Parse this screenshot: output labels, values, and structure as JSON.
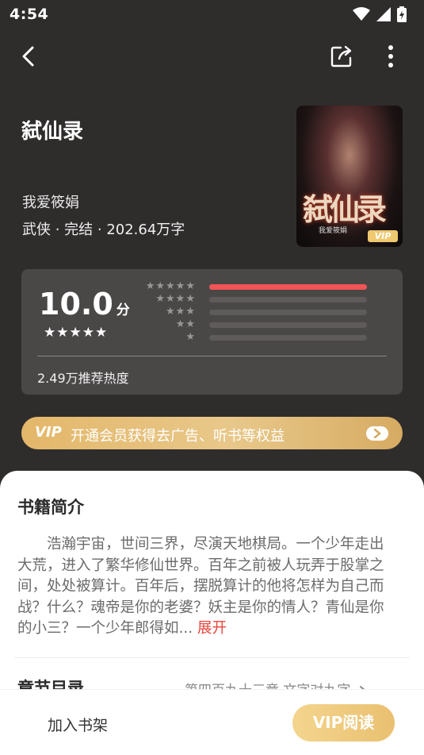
{
  "status": {
    "time": "4:54"
  },
  "book": {
    "title": "弑仙录",
    "author": "我爱筱娟",
    "meta": "武侠 · 完结 · 202.64万字",
    "cover": {
      "title": "弑仙录",
      "subtitle": "我爱筱娟",
      "badge": "VIP"
    }
  },
  "rating": {
    "score": "10.0",
    "unit": "分",
    "stars": "★★★★★",
    "breakdown": [
      {
        "stars": "★★★★★",
        "fraction": 1.0
      },
      {
        "stars": "★★★★",
        "fraction": 0.0
      },
      {
        "stars": "★★★",
        "fraction": 0.0
      },
      {
        "stars": "★★",
        "fraction": 0.0
      },
      {
        "stars": "★",
        "fraction": 0.0
      }
    ],
    "heat": "2.49万推荐热度"
  },
  "vip_banner": {
    "logo": "VIP",
    "text": "开通会员获得去广告、听书等权益"
  },
  "intro": {
    "heading": "书籍简介",
    "text": "浩瀚宇宙，世间三界，尽演天地棋局。一个少年走出大荒，进入了繁华修仙世界。百年之前被人玩弄于股掌之间，处处被算计。百年后，摆脱算计的他将怎样为自己而战？什么？魂帝是你的老婆？妖主是你的情人？青仙是你的小三？一个少年郎得如...",
    "expand": "展开"
  },
  "toc": {
    "heading": "章节目录",
    "latest": "第四百九十三章 文字对九字"
  },
  "bottom": {
    "shelf": "加入书架",
    "read": "VIP阅读"
  },
  "colors": {
    "accent": "#f25555",
    "gold": "#e3b76a",
    "background": "#2f2c2c"
  }
}
